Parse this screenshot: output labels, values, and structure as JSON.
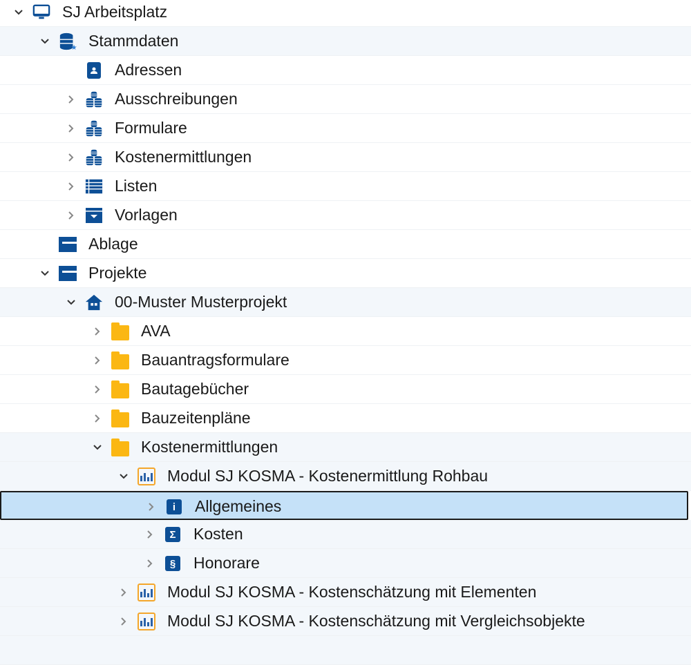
{
  "tree": [
    {
      "label": "SJ Arbeitsplatz",
      "level": 0,
      "state": "expanded",
      "icon": "computer-icon"
    },
    {
      "label": "Stammdaten",
      "level": 1,
      "state": "expanded",
      "icon": "database-icon",
      "shade": true
    },
    {
      "label": "Adressen",
      "level": 2,
      "state": "leaf",
      "icon": "address-book-icon"
    },
    {
      "label": "Ausschreibungen",
      "level": 2,
      "state": "collapsed",
      "icon": "coin-stacks-icon"
    },
    {
      "label": "Formulare",
      "level": 2,
      "state": "collapsed",
      "icon": "coin-stacks-icon"
    },
    {
      "label": "Kostenermittlungen",
      "level": 2,
      "state": "collapsed",
      "icon": "coin-stacks-icon"
    },
    {
      "label": "Listen",
      "level": 2,
      "state": "collapsed",
      "icon": "list-icon"
    },
    {
      "label": "Vorlagen",
      "level": 2,
      "state": "collapsed",
      "icon": "template-box-icon"
    },
    {
      "label": "Ablage",
      "level": 1,
      "state": "leaf",
      "icon": "blue-folder-icon"
    },
    {
      "label": "Projekte",
      "level": 1,
      "state": "expanded",
      "icon": "blue-folder-icon"
    },
    {
      "label": "00-Muster Musterprojekt",
      "level": 2,
      "state": "expanded",
      "icon": "house-icon",
      "shade": true
    },
    {
      "label": "AVA",
      "level": 3,
      "state": "collapsed",
      "icon": "folder-icon"
    },
    {
      "label": "Bauantragsformulare",
      "level": 3,
      "state": "collapsed",
      "icon": "folder-icon"
    },
    {
      "label": "Bautagebücher",
      "level": 3,
      "state": "collapsed",
      "icon": "folder-icon"
    },
    {
      "label": "Bauzeitenpläne",
      "level": 3,
      "state": "collapsed",
      "icon": "folder-icon"
    },
    {
      "label": "Kostenermittlungen",
      "level": 3,
      "state": "expanded",
      "icon": "folder-icon",
      "shade": true
    },
    {
      "label": "Modul SJ KOSMA - Kostenermittlung Rohbau",
      "level": 4,
      "state": "expanded",
      "icon": "kosma-module-icon",
      "shade": true
    },
    {
      "label": "Allgemeines",
      "level": 5,
      "state": "collapsed",
      "icon": "info-icon",
      "glyph": "i",
      "selected": true
    },
    {
      "label": "Kosten",
      "level": 5,
      "state": "collapsed",
      "icon": "sigma-icon",
      "glyph": "Σ",
      "shade": true
    },
    {
      "label": "Honorare",
      "level": 5,
      "state": "collapsed",
      "icon": "paragraph-icon",
      "glyph": "§",
      "shade": true
    },
    {
      "label": "Modul SJ KOSMA - Kostenschätzung mit Elementen",
      "level": 4,
      "state": "collapsed",
      "icon": "kosma-module-icon",
      "shade": true
    },
    {
      "label": "Modul SJ KOSMA - Kostenschätzung mit Vergleichsobjekte",
      "level": 4,
      "state": "collapsed",
      "icon": "kosma-module-icon",
      "shade": true
    }
  ],
  "colors": {
    "selection": "#c5e1f8",
    "icon_blue": "#0d4f96",
    "folder_yellow": "#fbb713",
    "module_border": "#f4a62a"
  }
}
